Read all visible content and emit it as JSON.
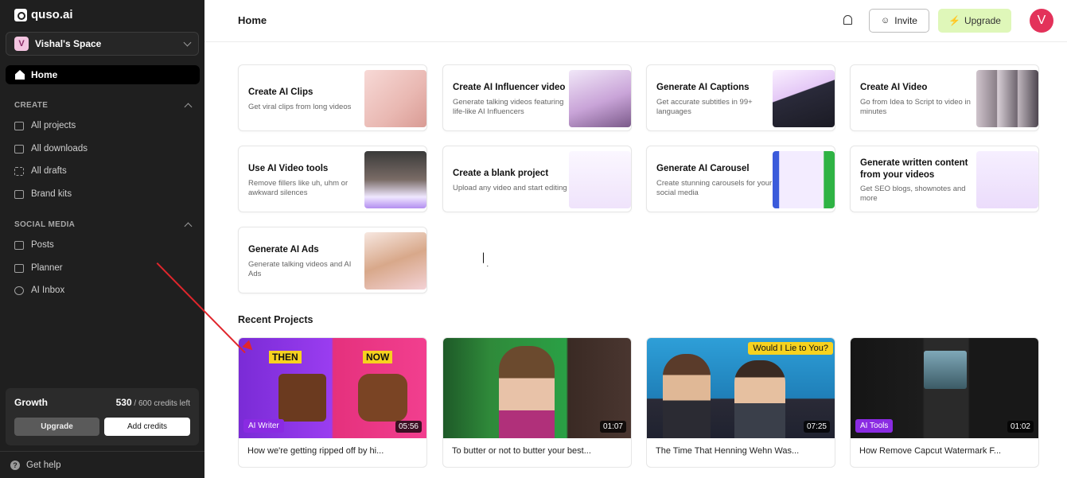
{
  "app": {
    "logo": "quso.ai"
  },
  "sidebar": {
    "workspace": {
      "initial": "V",
      "name": "Vishal's Space"
    },
    "home": "Home",
    "create_header": "CREATE",
    "create_items": [
      "All projects",
      "All downloads",
      "All drafts",
      "Brand kits"
    ],
    "social_header": "SOCIAL MEDIA",
    "social_items": [
      "Posts",
      "Planner",
      "AI Inbox"
    ],
    "plan": {
      "name": "Growth",
      "credits_used": "530",
      "credits_suffix": "/ 600 credits left",
      "upgrade_label": "Upgrade",
      "add_credits_label": "Add credits"
    },
    "help": "Get help"
  },
  "header": {
    "title": "Home",
    "invite_label": "Invite",
    "upgrade_label": "Upgrade",
    "avatar_initial": "V"
  },
  "tools": [
    {
      "title": "Create AI Clips",
      "desc": "Get viral clips from long videos"
    },
    {
      "title": "Create AI Influencer video",
      "desc": "Generate talking videos featuring life-like AI Influencers"
    },
    {
      "title": "Generate AI Captions",
      "desc": "Get accurate subtitles in 99+ languages"
    },
    {
      "title": "Create AI Video",
      "desc": "Go from Idea to Script to video in minutes"
    },
    {
      "title": "Use AI Video tools",
      "desc": "Remove fillers like uh, uhm or awkward silences"
    },
    {
      "title": "Create a blank project",
      "desc": "Upload any video and start editing"
    },
    {
      "title": "Generate AI Carousel",
      "desc": "Create stunning carousels for your social media"
    },
    {
      "title": "Generate written content from your videos",
      "desc": "Get SEO blogs, shownotes and more"
    },
    {
      "title": "Generate AI Ads",
      "desc": "Generate talking videos and AI Ads"
    }
  ],
  "recent": {
    "title": "Recent Projects",
    "projects": [
      {
        "name": "How we're getting ripped off by hi...",
        "duration": "05:56",
        "tag": "AI Writer",
        "overlay_left": "THEN",
        "overlay_right": "NOW"
      },
      {
        "name": "To butter or not to butter your best...",
        "duration": "01:07"
      },
      {
        "name": "The Time That Henning Wehn Was...",
        "duration": "07:25",
        "overlay": "Would I Lie to You?"
      },
      {
        "name": "How Remove Capcut Watermark F...",
        "duration": "01:02",
        "tag": "AI Tools"
      }
    ]
  }
}
